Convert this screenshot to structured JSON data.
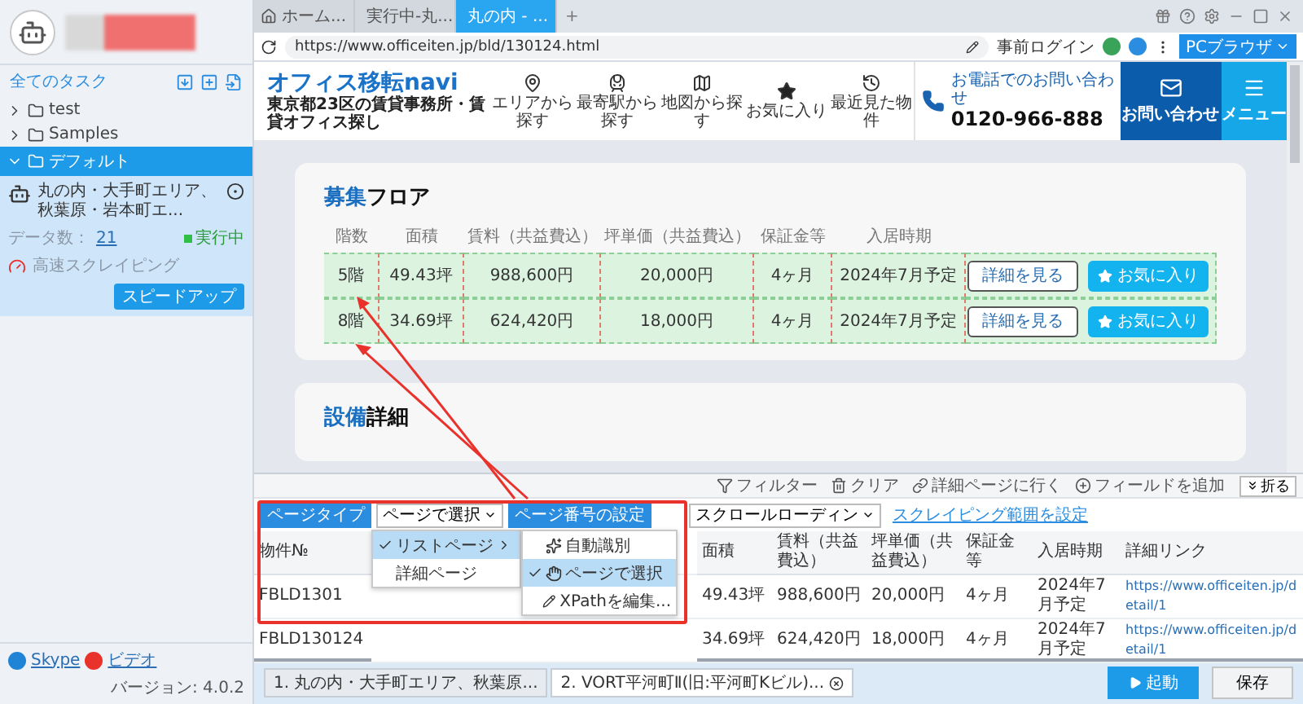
{
  "sidebar": {
    "header": "全てのタスク",
    "folders": [
      {
        "label": "test",
        "expanded": false,
        "selected": false
      },
      {
        "label": "Samples",
        "expanded": false,
        "selected": false
      },
      {
        "label": "デフォルト",
        "expanded": true,
        "selected": true
      }
    ],
    "task": {
      "title": "丸の内・大手町エリア、秋葉原・岩本町エ...",
      "data_label": "データ数：",
      "data_count": "21",
      "status": "実行中",
      "mode": "高速スクレイピング",
      "button": "スピードアップ"
    },
    "footer": {
      "links": [
        "Skype",
        "ビデオ"
      ],
      "version": "バージョン: 4.0.2"
    }
  },
  "browser": {
    "tabs": [
      {
        "label": "ホーム...",
        "kind": "home",
        "selected": false
      },
      {
        "label": "実行中-丸...",
        "kind": "page",
        "selected": false
      },
      {
        "label": "丸の内 - ...",
        "kind": "page",
        "selected": true
      }
    ],
    "new_tab": "+",
    "url": "https://www.officeiten.jp/bld/130124.html",
    "login": "事前ログイン",
    "mode_button": "PCブラウザ"
  },
  "site": {
    "logo": "オフィス移転",
    "logo_suffix": "navi",
    "tagline": "東京都23区の賃貸事務所・賃貸オフィス探し",
    "nav": [
      {
        "label": "エリアから探す",
        "kind": "pin"
      },
      {
        "label": "最寄駅から探す",
        "kind": "train"
      },
      {
        "label": "地図から探す",
        "kind": "map"
      },
      {
        "label": "お気に入り",
        "kind": "star"
      },
      {
        "label": "最近見た物件",
        "kind": "history"
      }
    ],
    "phone_label": "お電話でのお問い合わせ",
    "phone": "0120-966-888",
    "contact": "お問い合わせ",
    "menu": "メニュー"
  },
  "floors": {
    "title_accent": "募集",
    "title_rest": "フロア",
    "columns": [
      "階数",
      "面積",
      "賃料（共益費込）",
      "坪単価（共益費込）",
      "保証金等",
      "入居時期"
    ],
    "rows": [
      {
        "cells": [
          "5階",
          "49.43坪",
          "988,600円",
          "20,000円",
          "4ヶ月",
          "2024年7月予定"
        ],
        "detail": "詳細を見る",
        "favorite": "お気に入り"
      },
      {
        "cells": [
          "8階",
          "34.69坪",
          "624,420円",
          "18,000円",
          "4ヶ月",
          "2024年7月予定"
        ],
        "detail": "詳細を見る",
        "favorite": "お気に入り"
      }
    ]
  },
  "facilities": {
    "title_accent": "設備",
    "title_rest": "詳細"
  },
  "panel": {
    "collapse": "折る",
    "page_type_label": "ページタイプ",
    "page_type_value": "ページで選択",
    "paging_label": "ページ番号の設定",
    "paging_value": "スクロールローディン",
    "range_link": "スクレイピング範囲を設定",
    "actions": [
      {
        "label": "フィルター",
        "kind": "filter"
      },
      {
        "label": "クリア",
        "kind": "clear"
      },
      {
        "label": "詳細ページに行く",
        "kind": "link"
      },
      {
        "label": "フィールドを追加",
        "kind": "add"
      }
    ],
    "columns": [
      "物件№",
      "面積",
      "賃料（共益費込）",
      "坪単価（共益費込）",
      "保証金等",
      "入居時期",
      "詳細リンク"
    ],
    "rows": [
      [
        "FBLD1301",
        "49.43坪",
        "988,600円",
        "20,000円",
        "4ヶ月",
        "2024年7月予定",
        "https://www.officeiten.jp/detail/1"
      ],
      [
        "FBLD130124",
        "34.69坪",
        "624,420円",
        "18,000円",
        "4ヶ月",
        "2024年7月予定",
        "https://www.officeiten.jp/detail/1"
      ]
    ],
    "page_menu": [
      {
        "label": "リストページ",
        "selected": true
      },
      {
        "label": "詳細ページ",
        "selected": false
      }
    ],
    "paging_menu": [
      {
        "label": "自動識別",
        "kind": "auto",
        "selected": false
      },
      {
        "label": "ページで選択",
        "kind": "click",
        "selected": true
      },
      {
        "label": "XPathを編集...",
        "kind": "edit",
        "selected": false
      }
    ]
  },
  "task_tabs": [
    {
      "label": "1. 丸の内・大手町エリア、秋葉原...",
      "selected": false
    },
    {
      "label": "2. VORT平河町Ⅱ(旧:平河町Kビル)...",
      "selected": true
    }
  ],
  "run_button": "起動",
  "save_button": "保存"
}
